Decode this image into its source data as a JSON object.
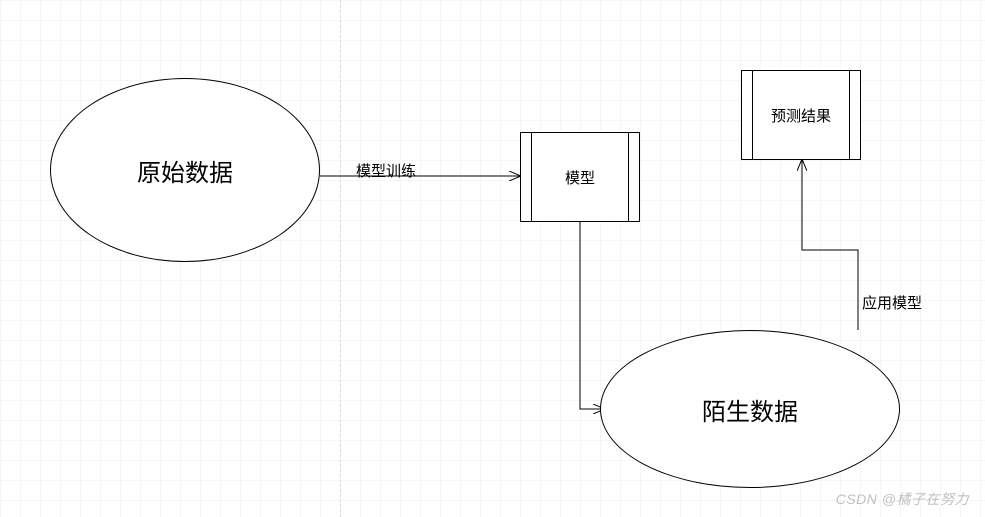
{
  "diagram": {
    "nodes": {
      "raw_data": {
        "label": "原始数据",
        "shape": "ellipse"
      },
      "model": {
        "label": "模型",
        "shape": "rect-predefined"
      },
      "prediction": {
        "label": "预测结果",
        "shape": "rect-predefined"
      },
      "unknown_data": {
        "label": "陌生数据",
        "shape": "ellipse"
      }
    },
    "edges": {
      "train": {
        "from": "raw_data",
        "to": "model",
        "label": "模型训练"
      },
      "to_unknown": {
        "from": "model",
        "to": "unknown_data",
        "label": ""
      },
      "apply": {
        "from": "unknown_data",
        "to": "prediction",
        "label": "应用模型"
      }
    }
  },
  "watermark": "CSDN @橘子在努力",
  "colors": {
    "stroke": "#000000",
    "grid": "#f5f5f5",
    "guide": "#dcdcdc"
  }
}
